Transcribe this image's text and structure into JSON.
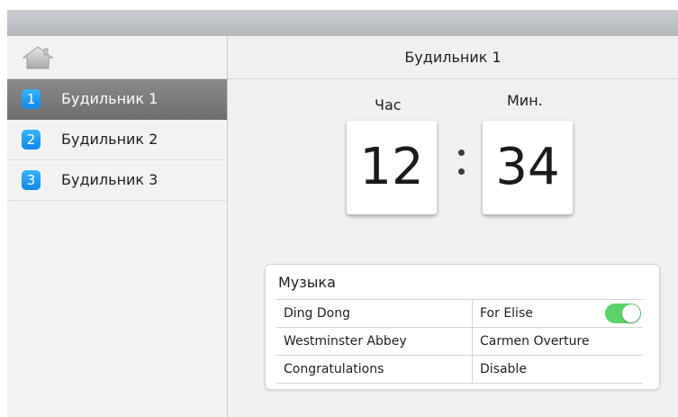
{
  "header": {
    "title": "Будильник 1"
  },
  "sidebar": {
    "home_icon": "home-icon",
    "items": [
      {
        "number": "1",
        "label": "Будильник 1",
        "active": true
      },
      {
        "number": "2",
        "label": "Будильник 2",
        "active": false
      },
      {
        "number": "3",
        "label": "Будильник 3",
        "active": false
      }
    ]
  },
  "time": {
    "hour_label": "Час",
    "minute_label": "Мин.",
    "hour": "12",
    "minute": "34",
    "separator": ":"
  },
  "music": {
    "title": "Музыка",
    "rows": [
      {
        "left": "Ding Dong",
        "right": "For Elise",
        "right_toggle": true
      },
      {
        "left": "Westminster Abbey",
        "right": "Carmen Overture"
      },
      {
        "left": "Congratulations",
        "right": "Disable"
      }
    ],
    "toggle_on": true
  },
  "colors": {
    "accent_blue": "#1a9bf2",
    "toggle_green": "#5bd36a",
    "active_item": "#7a7a7a"
  }
}
